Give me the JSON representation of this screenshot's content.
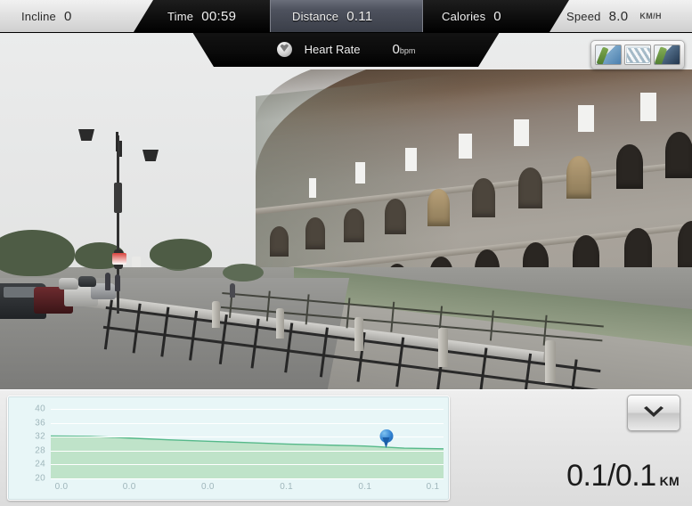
{
  "hud": {
    "metrics": [
      {
        "name": "incline",
        "label": "Incline",
        "value": "0",
        "unit": ""
      },
      {
        "name": "time",
        "label": "Time",
        "value": "00:59",
        "unit": ""
      },
      {
        "name": "distance",
        "label": "Distance",
        "value": "0.11",
        "unit": ""
      },
      {
        "name": "calories",
        "label": "Calories",
        "value": "0",
        "unit": ""
      },
      {
        "name": "speed",
        "label": "Speed",
        "value": "8.0",
        "unit": "KM/H"
      }
    ],
    "heart_rate": {
      "label": "Heart Rate",
      "value": "0",
      "unit": "bpm",
      "icon": "heart-icon"
    }
  },
  "view_modes": [
    {
      "name": "view-mode-map",
      "icon": "map-thumbnail-icon"
    },
    {
      "name": "view-mode-satellite",
      "icon": "satellite-thumbnail-icon"
    },
    {
      "name": "view-mode-hybrid",
      "icon": "hybrid-thumbnail-icon"
    }
  ],
  "bottom": {
    "distance_readout": {
      "value": "0.1/0.1",
      "unit": "KM"
    },
    "collapse_button": {
      "name": "collapse-panel-button",
      "icon": "chevron-down-icon"
    }
  },
  "colors": {
    "accent_blue": "#2f7fd0",
    "chart_bg": "#e8f6f7",
    "chart_fill": "#bfe3c9",
    "chart_line": "#56b98a",
    "hud_highlight": "#4e525e"
  },
  "chart_data": {
    "type": "area",
    "title": "",
    "xlabel": "",
    "ylabel": "",
    "grid": true,
    "legend": "none",
    "xlim": [
      0.0,
      0.11
    ],
    "ylim": [
      20,
      40
    ],
    "yticks": [
      "40",
      "36",
      "32",
      "28",
      "24",
      "20"
    ],
    "ytick_values": [
      40,
      36,
      32,
      28,
      24,
      20
    ],
    "xticks": [
      "0.0",
      "0.0",
      "0.0",
      "0.1",
      "0.1",
      "0.1"
    ],
    "xtick_values": [
      0.0,
      0.022,
      0.044,
      0.066,
      0.088,
      0.11
    ],
    "x": [
      0.0,
      0.011,
      0.022,
      0.033,
      0.044,
      0.055,
      0.066,
      0.077,
      0.088,
      0.099,
      0.11
    ],
    "y": [
      32.2,
      32.1,
      31.6,
      31.1,
      30.7,
      30.3,
      29.9,
      29.6,
      29.3,
      28.7,
      28.5
    ],
    "marker": {
      "name": "current-position-marker",
      "x": 0.094,
      "y": 28.8
    }
  }
}
